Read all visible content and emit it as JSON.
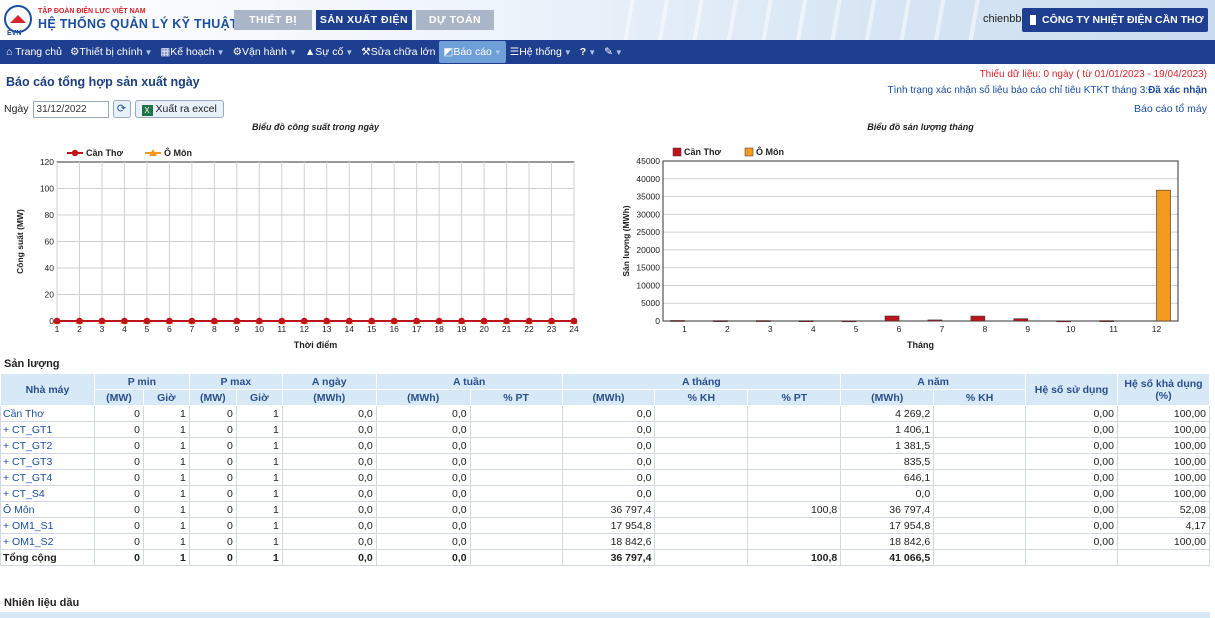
{
  "header": {
    "org": "TẬP ĐOÀN ĐIỆN LỰC VIỆT NAM",
    "system": "HỆ THỐNG QUẢN LÝ KỸ THUẬT",
    "logo_text": "EVN",
    "tabs": [
      {
        "label": "THIẾT BỊ"
      },
      {
        "label": "SẢN XUẤT ĐIỆN"
      },
      {
        "label": "DỰ TOÁN"
      }
    ],
    "user": "chienbb",
    "company": "CÔNG TY NHIỆT ĐIỆN CẦN THƠ"
  },
  "nav": [
    {
      "label": "Trang chủ",
      "icon": "home-icon"
    },
    {
      "label": "Thiết bị chính",
      "icon": "gears-icon"
    },
    {
      "label": "Kế hoạch",
      "icon": "calendar-icon"
    },
    {
      "label": "Vận hành",
      "icon": "cogs-icon"
    },
    {
      "label": "Sự cố",
      "icon": "warning-icon"
    },
    {
      "label": "Sửa chữa lớn",
      "icon": "wrench-icon"
    },
    {
      "label": "Báo cáo",
      "icon": "chart-icon"
    },
    {
      "label": "Hệ thống",
      "icon": "list-icon"
    },
    {
      "label": "?",
      "icon": "help-icon"
    },
    {
      "label": "",
      "icon": "tools-icon"
    }
  ],
  "page": {
    "title": "Báo cáo tổng hợp sản xuất ngày",
    "missing_data": "Thiếu dữ liệu: 0 ngày ( từ 01/01/2023 - 19/04/2023)",
    "confirm_status_label": "Tình trạng xác nhận số liệu báo cáo chỉ tiêu KTKT tháng 3:",
    "confirm_status_value": "Đã xác nhận",
    "unit_report_link": "Báo cáo tổ máy",
    "date_label": "Ngày",
    "date_value": "31/12/2022",
    "refresh_glyph": "⟳",
    "export_label": "Xuất ra excel",
    "section_output": "Sản lượng",
    "section_fuel": "Nhiên liệu dầu"
  },
  "colors": {
    "nav_bg": "#1e3f8f",
    "can_tho": "#c0141c",
    "o_mon": "#f39a1e",
    "header_text": "#2a4f8a",
    "link": "#1b4ea0",
    "missing": "#d9242b"
  },
  "chart_data": [
    {
      "type": "line",
      "title": "Biểu đồ công suất trong ngày",
      "xlabel": "Thời điểm",
      "ylabel": "Công suất (MW)",
      "x": [
        1,
        2,
        3,
        4,
        5,
        6,
        7,
        8,
        9,
        10,
        11,
        12,
        13,
        14,
        15,
        16,
        17,
        18,
        19,
        20,
        21,
        22,
        23,
        24
      ],
      "ylim": [
        0,
        120
      ],
      "yticks": [
        0,
        20,
        40,
        60,
        80,
        100,
        120
      ],
      "grid": true,
      "legend": "top-left",
      "series": [
        {
          "name": "Cần Thơ",
          "color": "#c0141c",
          "marker": "circle",
          "values": [
            0,
            0,
            0,
            0,
            0,
            0,
            0,
            0,
            0,
            0,
            0,
            0,
            0,
            0,
            0,
            0,
            0,
            0,
            0,
            0,
            0,
            0,
            0,
            0
          ]
        },
        {
          "name": "Ô Môn",
          "color": "#f39a1e",
          "marker": "triangle",
          "values": [
            0,
            0,
            0,
            0,
            0,
            0,
            0,
            0,
            0,
            0,
            0,
            0,
            0,
            0,
            0,
            0,
            0,
            0,
            0,
            0,
            0,
            0,
            0,
            0
          ]
        }
      ]
    },
    {
      "type": "bar",
      "title": "Biểu đồ sản lượng tháng",
      "xlabel": "Tháng",
      "ylabel": "Sản lượng (MWh)",
      "categories": [
        "1",
        "2",
        "3",
        "4",
        "5",
        "6",
        "7",
        "8",
        "9",
        "10",
        "11",
        "12"
      ],
      "ylim": [
        0,
        45000
      ],
      "yticks": [
        0,
        5000,
        10000,
        15000,
        20000,
        25000,
        30000,
        35000,
        40000,
        45000
      ],
      "grid": true,
      "legend": "top-left",
      "series": [
        {
          "name": "Cần Thơ",
          "color": "#c0141c",
          "values": [
            150,
            100,
            120,
            80,
            60,
            1406,
            300,
            1382,
            646,
            50,
            100,
            0
          ]
        },
        {
          "name": "Ô Môn",
          "color": "#f39a1e",
          "values": [
            0,
            0,
            0,
            0,
            0,
            0,
            0,
            0,
            0,
            0,
            0,
            36797
          ]
        }
      ]
    }
  ],
  "table": {
    "h_plant": "Nhà máy",
    "h_pmin": "P min",
    "h_pmax": "P max",
    "h_aday": "A ngày",
    "h_aweek": "A tuần",
    "h_amonth": "A tháng",
    "h_ayear": "A năm",
    "h_usage": "Hệ số sử dụng",
    "h_avail": "Hệ số khả dụng (%)",
    "h_mw": "(MW)",
    "h_hour": "Giờ",
    "h_mwh": "(MWh)",
    "h_pt": "% PT",
    "h_kh": "% KH",
    "rows": [
      {
        "name": "Cần Thơ",
        "pmin": "0",
        "pmin_h": "1",
        "pmax": "0",
        "pmax_h": "1",
        "aday": "0,0",
        "aweek": "0,0",
        "aweek_pt": "",
        "amonth": "0,0",
        "amonth_kh": "",
        "amonth_pt": "",
        "ayear": "4 269,2",
        "ayear_kh": "",
        "usage": "0,00",
        "avail": "100,00"
      },
      {
        "name": "+ CT_GT1",
        "pmin": "0",
        "pmin_h": "1",
        "pmax": "0",
        "pmax_h": "1",
        "aday": "0,0",
        "aweek": "0,0",
        "aweek_pt": "",
        "amonth": "0,0",
        "amonth_kh": "",
        "amonth_pt": "",
        "ayear": "1 406,1",
        "ayear_kh": "",
        "usage": "0,00",
        "avail": "100,00"
      },
      {
        "name": "+ CT_GT2",
        "pmin": "0",
        "pmin_h": "1",
        "pmax": "0",
        "pmax_h": "1",
        "aday": "0,0",
        "aweek": "0,0",
        "aweek_pt": "",
        "amonth": "0,0",
        "amonth_kh": "",
        "amonth_pt": "",
        "ayear": "1 381,5",
        "ayear_kh": "",
        "usage": "0,00",
        "avail": "100,00"
      },
      {
        "name": "+ CT_GT3",
        "pmin": "0",
        "pmin_h": "1",
        "pmax": "0",
        "pmax_h": "1",
        "aday": "0,0",
        "aweek": "0,0",
        "aweek_pt": "",
        "amonth": "0,0",
        "amonth_kh": "",
        "amonth_pt": "",
        "ayear": "835,5",
        "ayear_kh": "",
        "usage": "0,00",
        "avail": "100,00"
      },
      {
        "name": "+ CT_GT4",
        "pmin": "0",
        "pmin_h": "1",
        "pmax": "0",
        "pmax_h": "1",
        "aday": "0,0",
        "aweek": "0,0",
        "aweek_pt": "",
        "amonth": "0,0",
        "amonth_kh": "",
        "amonth_pt": "",
        "ayear": "646,1",
        "ayear_kh": "",
        "usage": "0,00",
        "avail": "100,00"
      },
      {
        "name": "+ CT_S4",
        "pmin": "0",
        "pmin_h": "1",
        "pmax": "0",
        "pmax_h": "1",
        "aday": "0,0",
        "aweek": "0,0",
        "aweek_pt": "",
        "amonth": "0,0",
        "amonth_kh": "",
        "amonth_pt": "",
        "ayear": "0,0",
        "ayear_kh": "",
        "usage": "0,00",
        "avail": "100,00"
      },
      {
        "name": "Ô Môn",
        "pmin": "0",
        "pmin_h": "1",
        "pmax": "0",
        "pmax_h": "1",
        "aday": "0,0",
        "aweek": "0,0",
        "aweek_pt": "",
        "amonth": "36 797,4",
        "amonth_kh": "",
        "amonth_pt": "100,8",
        "ayear": "36 797,4",
        "ayear_kh": "",
        "usage": "0,00",
        "avail": "52,08"
      },
      {
        "name": "+ OM1_S1",
        "pmin": "0",
        "pmin_h": "1",
        "pmax": "0",
        "pmax_h": "1",
        "aday": "0,0",
        "aweek": "0,0",
        "aweek_pt": "",
        "amonth": "17 954,8",
        "amonth_kh": "",
        "amonth_pt": "",
        "ayear": "17 954,8",
        "ayear_kh": "",
        "usage": "0,00",
        "avail": "4,17"
      },
      {
        "name": "+ OM1_S2",
        "pmin": "0",
        "pmin_h": "1",
        "pmax": "0",
        "pmax_h": "1",
        "aday": "0,0",
        "aweek": "0,0",
        "aweek_pt": "",
        "amonth": "18 842,6",
        "amonth_kh": "",
        "amonth_pt": "",
        "ayear": "18 842,6",
        "ayear_kh": "",
        "usage": "0,00",
        "avail": "100,00"
      }
    ],
    "total": {
      "name": "Tổng cộng",
      "pmin": "0",
      "pmin_h": "1",
      "pmax": "0",
      "pmax_h": "1",
      "aday": "0,0",
      "aweek": "0,0",
      "aweek_pt": "",
      "amonth": "36 797,4",
      "amonth_kh": "",
      "amonth_pt": "100,8",
      "ayear": "41 066,5",
      "ayear_kh": "",
      "usage": "",
      "avail": ""
    }
  }
}
